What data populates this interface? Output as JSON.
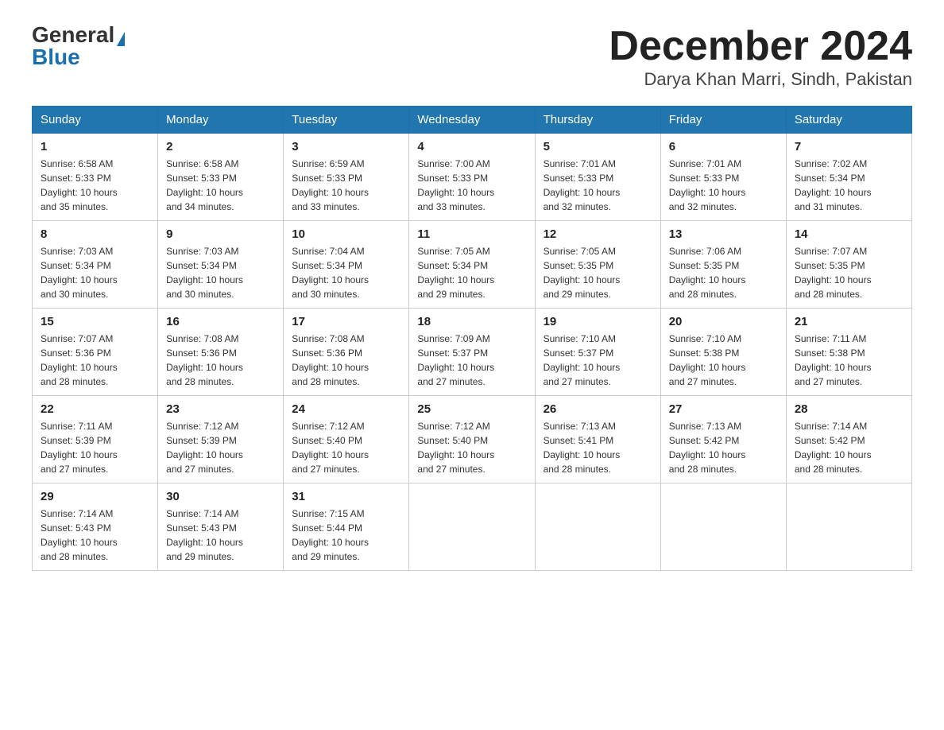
{
  "header": {
    "logo_general": "General",
    "logo_blue": "Blue",
    "month_title": "December 2024",
    "location": "Darya Khan Marri, Sindh, Pakistan"
  },
  "days_of_week": [
    "Sunday",
    "Monday",
    "Tuesday",
    "Wednesday",
    "Thursday",
    "Friday",
    "Saturday"
  ],
  "weeks": [
    [
      {
        "day": "1",
        "sunrise": "6:58 AM",
        "sunset": "5:33 PM",
        "daylight": "10 hours and 35 minutes."
      },
      {
        "day": "2",
        "sunrise": "6:58 AM",
        "sunset": "5:33 PM",
        "daylight": "10 hours and 34 minutes."
      },
      {
        "day": "3",
        "sunrise": "6:59 AM",
        "sunset": "5:33 PM",
        "daylight": "10 hours and 33 minutes."
      },
      {
        "day": "4",
        "sunrise": "7:00 AM",
        "sunset": "5:33 PM",
        "daylight": "10 hours and 33 minutes."
      },
      {
        "day": "5",
        "sunrise": "7:01 AM",
        "sunset": "5:33 PM",
        "daylight": "10 hours and 32 minutes."
      },
      {
        "day": "6",
        "sunrise": "7:01 AM",
        "sunset": "5:33 PM",
        "daylight": "10 hours and 32 minutes."
      },
      {
        "day": "7",
        "sunrise": "7:02 AM",
        "sunset": "5:34 PM",
        "daylight": "10 hours and 31 minutes."
      }
    ],
    [
      {
        "day": "8",
        "sunrise": "7:03 AM",
        "sunset": "5:34 PM",
        "daylight": "10 hours and 30 minutes."
      },
      {
        "day": "9",
        "sunrise": "7:03 AM",
        "sunset": "5:34 PM",
        "daylight": "10 hours and 30 minutes."
      },
      {
        "day": "10",
        "sunrise": "7:04 AM",
        "sunset": "5:34 PM",
        "daylight": "10 hours and 30 minutes."
      },
      {
        "day": "11",
        "sunrise": "7:05 AM",
        "sunset": "5:34 PM",
        "daylight": "10 hours and 29 minutes."
      },
      {
        "day": "12",
        "sunrise": "7:05 AM",
        "sunset": "5:35 PM",
        "daylight": "10 hours and 29 minutes."
      },
      {
        "day": "13",
        "sunrise": "7:06 AM",
        "sunset": "5:35 PM",
        "daylight": "10 hours and 28 minutes."
      },
      {
        "day": "14",
        "sunrise": "7:07 AM",
        "sunset": "5:35 PM",
        "daylight": "10 hours and 28 minutes."
      }
    ],
    [
      {
        "day": "15",
        "sunrise": "7:07 AM",
        "sunset": "5:36 PM",
        "daylight": "10 hours and 28 minutes."
      },
      {
        "day": "16",
        "sunrise": "7:08 AM",
        "sunset": "5:36 PM",
        "daylight": "10 hours and 28 minutes."
      },
      {
        "day": "17",
        "sunrise": "7:08 AM",
        "sunset": "5:36 PM",
        "daylight": "10 hours and 28 minutes."
      },
      {
        "day": "18",
        "sunrise": "7:09 AM",
        "sunset": "5:37 PM",
        "daylight": "10 hours and 27 minutes."
      },
      {
        "day": "19",
        "sunrise": "7:10 AM",
        "sunset": "5:37 PM",
        "daylight": "10 hours and 27 minutes."
      },
      {
        "day": "20",
        "sunrise": "7:10 AM",
        "sunset": "5:38 PM",
        "daylight": "10 hours and 27 minutes."
      },
      {
        "day": "21",
        "sunrise": "7:11 AM",
        "sunset": "5:38 PM",
        "daylight": "10 hours and 27 minutes."
      }
    ],
    [
      {
        "day": "22",
        "sunrise": "7:11 AM",
        "sunset": "5:39 PM",
        "daylight": "10 hours and 27 minutes."
      },
      {
        "day": "23",
        "sunrise": "7:12 AM",
        "sunset": "5:39 PM",
        "daylight": "10 hours and 27 minutes."
      },
      {
        "day": "24",
        "sunrise": "7:12 AM",
        "sunset": "5:40 PM",
        "daylight": "10 hours and 27 minutes."
      },
      {
        "day": "25",
        "sunrise": "7:12 AM",
        "sunset": "5:40 PM",
        "daylight": "10 hours and 27 minutes."
      },
      {
        "day": "26",
        "sunrise": "7:13 AM",
        "sunset": "5:41 PM",
        "daylight": "10 hours and 28 minutes."
      },
      {
        "day": "27",
        "sunrise": "7:13 AM",
        "sunset": "5:42 PM",
        "daylight": "10 hours and 28 minutes."
      },
      {
        "day": "28",
        "sunrise": "7:14 AM",
        "sunset": "5:42 PM",
        "daylight": "10 hours and 28 minutes."
      }
    ],
    [
      {
        "day": "29",
        "sunrise": "7:14 AM",
        "sunset": "5:43 PM",
        "daylight": "10 hours and 28 minutes."
      },
      {
        "day": "30",
        "sunrise": "7:14 AM",
        "sunset": "5:43 PM",
        "daylight": "10 hours and 29 minutes."
      },
      {
        "day": "31",
        "sunrise": "7:15 AM",
        "sunset": "5:44 PM",
        "daylight": "10 hours and 29 minutes."
      },
      null,
      null,
      null,
      null
    ]
  ],
  "labels": {
    "sunrise": "Sunrise:",
    "sunset": "Sunset:",
    "daylight": "Daylight:"
  }
}
